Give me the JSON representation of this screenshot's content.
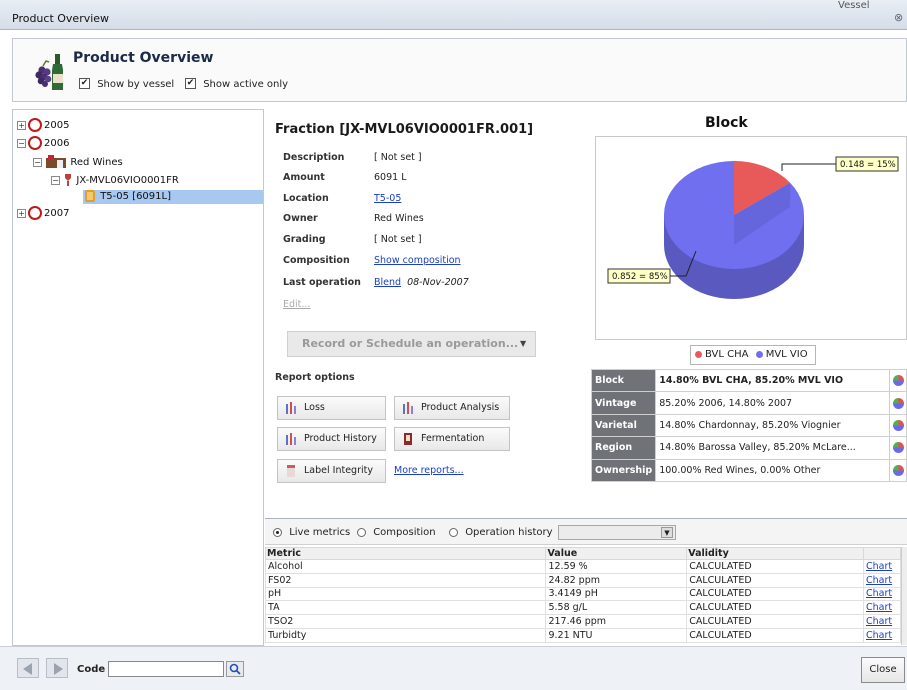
{
  "window": {
    "title": "Product Overview",
    "bg_text": "Vessel",
    "close_glyph": "⊗"
  },
  "header": {
    "title": "Product Overview",
    "show_by_vessel": {
      "label": "Show by vessel",
      "checked": true
    },
    "show_active_only": {
      "label": "Show active only",
      "checked": true
    }
  },
  "tree": {
    "y2005": "2005",
    "y2006": "2006",
    "red_wines": "Red Wines",
    "product": "JX-MVL06VIO0001FR",
    "vessel": "T5-05 [6091L]",
    "y2007": "2007"
  },
  "fraction": {
    "title": "Fraction [JX-MVL06VIO0001FR.001]",
    "props": {
      "description": {
        "label": "Description",
        "value": "[ Not set ]"
      },
      "amount": {
        "label": "Amount",
        "value": "6091 L"
      },
      "location": {
        "label": "Location",
        "value": "T5-05"
      },
      "owner": {
        "label": "Owner",
        "value": "Red Wines"
      },
      "grading": {
        "label": "Grading",
        "value": "[ Not set ]"
      },
      "composition": {
        "label": "Composition",
        "value": "Show composition"
      },
      "last_operation": {
        "label": "Last operation",
        "op": "Blend",
        "date": "08-Nov-2007"
      }
    },
    "edit": "Edit...",
    "record_button": "Record or Schedule an operation...",
    "report_options": "Report options",
    "reports": {
      "loss": "Loss",
      "product_analysis": "Product Analysis",
      "product_history": "Product History",
      "fermentation": "Fermentation",
      "label_integrity": "Label Integrity",
      "more_reports": "More reports..."
    }
  },
  "chart_data": {
    "type": "pie",
    "title": "Block",
    "categories": [
      "BVL CHA",
      "MVL VIO"
    ],
    "values": [
      0.148,
      0.852
    ],
    "labels": [
      "0.148 = 15%",
      "0.852 = 85%"
    ],
    "colors": [
      "#e85a5a",
      "#6f6ff0"
    ],
    "legend_position": "bottom"
  },
  "info": {
    "rows": [
      {
        "label": "Block",
        "value": "14.80% BVL CHA, 85.20% MVL VIO"
      },
      {
        "label": "Vintage",
        "value": "85.20% 2006, 14.80% 2007"
      },
      {
        "label": "Varietal",
        "value": "14.80% Chardonnay, 85.20% Viognier"
      },
      {
        "label": "Region",
        "value": "14.80% Barossa Valley, 85.20% McLare..."
      },
      {
        "label": "Ownership",
        "value": "100.00% Red Wines, 0.00% Other"
      }
    ]
  },
  "metrics": {
    "tabs": {
      "live": "Live metrics",
      "composition": "Composition",
      "history": "Operation history"
    },
    "headers": [
      "Metric",
      "Value",
      "Validity",
      ""
    ],
    "chart_label": "Chart",
    "rows": [
      [
        "Alcohol",
        "12.59 %",
        "CALCULATED"
      ],
      [
        "FS02",
        "24.82 ppm",
        "CALCULATED"
      ],
      [
        "pH",
        "3.4149 pH",
        "CALCULATED"
      ],
      [
        "TA",
        "5.58 g/L",
        "CALCULATED"
      ],
      [
        "TSO2",
        "217.46 ppm",
        "CALCULATED"
      ],
      [
        "Turbidty",
        "9.21 NTU",
        "CALCULATED"
      ]
    ]
  },
  "footer": {
    "code_label": "Code",
    "code_value": "",
    "close": "Close"
  }
}
